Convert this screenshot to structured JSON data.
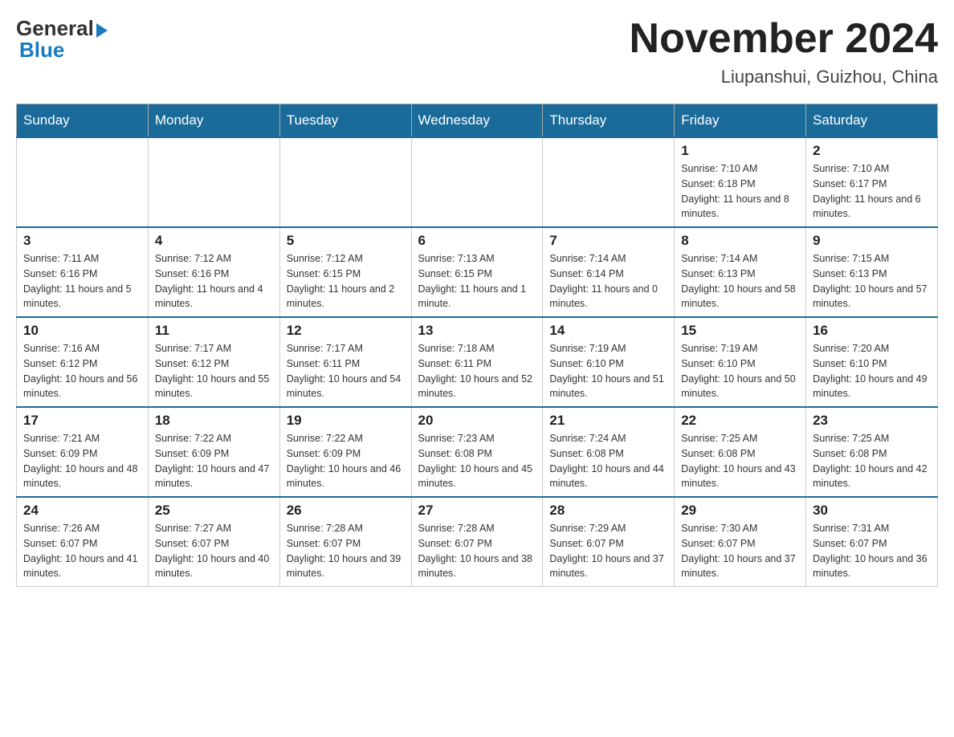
{
  "logo": {
    "general": "General",
    "blue": "Blue"
  },
  "title": "November 2024",
  "location": "Liupanshui, Guizhou, China",
  "weekdays": [
    "Sunday",
    "Monday",
    "Tuesday",
    "Wednesday",
    "Thursday",
    "Friday",
    "Saturday"
  ],
  "weeks": [
    [
      {
        "day": "",
        "info": ""
      },
      {
        "day": "",
        "info": ""
      },
      {
        "day": "",
        "info": ""
      },
      {
        "day": "",
        "info": ""
      },
      {
        "day": "",
        "info": ""
      },
      {
        "day": "1",
        "info": "Sunrise: 7:10 AM\nSunset: 6:18 PM\nDaylight: 11 hours and 8 minutes."
      },
      {
        "day": "2",
        "info": "Sunrise: 7:10 AM\nSunset: 6:17 PM\nDaylight: 11 hours and 6 minutes."
      }
    ],
    [
      {
        "day": "3",
        "info": "Sunrise: 7:11 AM\nSunset: 6:16 PM\nDaylight: 11 hours and 5 minutes."
      },
      {
        "day": "4",
        "info": "Sunrise: 7:12 AM\nSunset: 6:16 PM\nDaylight: 11 hours and 4 minutes."
      },
      {
        "day": "5",
        "info": "Sunrise: 7:12 AM\nSunset: 6:15 PM\nDaylight: 11 hours and 2 minutes."
      },
      {
        "day": "6",
        "info": "Sunrise: 7:13 AM\nSunset: 6:15 PM\nDaylight: 11 hours and 1 minute."
      },
      {
        "day": "7",
        "info": "Sunrise: 7:14 AM\nSunset: 6:14 PM\nDaylight: 11 hours and 0 minutes."
      },
      {
        "day": "8",
        "info": "Sunrise: 7:14 AM\nSunset: 6:13 PM\nDaylight: 10 hours and 58 minutes."
      },
      {
        "day": "9",
        "info": "Sunrise: 7:15 AM\nSunset: 6:13 PM\nDaylight: 10 hours and 57 minutes."
      }
    ],
    [
      {
        "day": "10",
        "info": "Sunrise: 7:16 AM\nSunset: 6:12 PM\nDaylight: 10 hours and 56 minutes."
      },
      {
        "day": "11",
        "info": "Sunrise: 7:17 AM\nSunset: 6:12 PM\nDaylight: 10 hours and 55 minutes."
      },
      {
        "day": "12",
        "info": "Sunrise: 7:17 AM\nSunset: 6:11 PM\nDaylight: 10 hours and 54 minutes."
      },
      {
        "day": "13",
        "info": "Sunrise: 7:18 AM\nSunset: 6:11 PM\nDaylight: 10 hours and 52 minutes."
      },
      {
        "day": "14",
        "info": "Sunrise: 7:19 AM\nSunset: 6:10 PM\nDaylight: 10 hours and 51 minutes."
      },
      {
        "day": "15",
        "info": "Sunrise: 7:19 AM\nSunset: 6:10 PM\nDaylight: 10 hours and 50 minutes."
      },
      {
        "day": "16",
        "info": "Sunrise: 7:20 AM\nSunset: 6:10 PM\nDaylight: 10 hours and 49 minutes."
      }
    ],
    [
      {
        "day": "17",
        "info": "Sunrise: 7:21 AM\nSunset: 6:09 PM\nDaylight: 10 hours and 48 minutes."
      },
      {
        "day": "18",
        "info": "Sunrise: 7:22 AM\nSunset: 6:09 PM\nDaylight: 10 hours and 47 minutes."
      },
      {
        "day": "19",
        "info": "Sunrise: 7:22 AM\nSunset: 6:09 PM\nDaylight: 10 hours and 46 minutes."
      },
      {
        "day": "20",
        "info": "Sunrise: 7:23 AM\nSunset: 6:08 PM\nDaylight: 10 hours and 45 minutes."
      },
      {
        "day": "21",
        "info": "Sunrise: 7:24 AM\nSunset: 6:08 PM\nDaylight: 10 hours and 44 minutes."
      },
      {
        "day": "22",
        "info": "Sunrise: 7:25 AM\nSunset: 6:08 PM\nDaylight: 10 hours and 43 minutes."
      },
      {
        "day": "23",
        "info": "Sunrise: 7:25 AM\nSunset: 6:08 PM\nDaylight: 10 hours and 42 minutes."
      }
    ],
    [
      {
        "day": "24",
        "info": "Sunrise: 7:26 AM\nSunset: 6:07 PM\nDaylight: 10 hours and 41 minutes."
      },
      {
        "day": "25",
        "info": "Sunrise: 7:27 AM\nSunset: 6:07 PM\nDaylight: 10 hours and 40 minutes."
      },
      {
        "day": "26",
        "info": "Sunrise: 7:28 AM\nSunset: 6:07 PM\nDaylight: 10 hours and 39 minutes."
      },
      {
        "day": "27",
        "info": "Sunrise: 7:28 AM\nSunset: 6:07 PM\nDaylight: 10 hours and 38 minutes."
      },
      {
        "day": "28",
        "info": "Sunrise: 7:29 AM\nSunset: 6:07 PM\nDaylight: 10 hours and 37 minutes."
      },
      {
        "day": "29",
        "info": "Sunrise: 7:30 AM\nSunset: 6:07 PM\nDaylight: 10 hours and 37 minutes."
      },
      {
        "day": "30",
        "info": "Sunrise: 7:31 AM\nSunset: 6:07 PM\nDaylight: 10 hours and 36 minutes."
      }
    ]
  ]
}
